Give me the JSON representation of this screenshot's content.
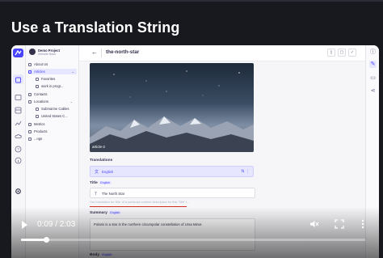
{
  "headline": "Use a Translation String",
  "rail": {
    "tooltip": "Settings"
  },
  "nav": {
    "project_name": "Demo Project",
    "project_sub": "Website Base",
    "items": [
      {
        "label": "About Us"
      },
      {
        "label": "Articles"
      },
      {
        "label": "Favorites"
      },
      {
        "label": "work in progr..."
      },
      {
        "label": "Contacts"
      },
      {
        "label": "Locations"
      },
      {
        "label": "Submarine Cables"
      },
      {
        "label": "United States C..."
      },
      {
        "label": "Metrics"
      },
      {
        "label": "Products"
      },
      {
        "label": "...ngs"
      }
    ]
  },
  "main": {
    "doc_title": "the-north-star",
    "image_caption": "article-2",
    "translations_label": "Translations",
    "translations_value": "English",
    "title_label": "Title",
    "title_badge": "English",
    "title_value": "The North Star",
    "title_hint": "Our translation for 'title' of a particular content description for this 'Title' t...",
    "summary_label": "Summary",
    "summary_badge": "English",
    "summary_value": "Polaris is a star in the northern circumpolar constellation of Ursa Minor.",
    "body_label": "Body",
    "body_badge": "English"
  },
  "video": {
    "current_time": "0:09",
    "duration": "2:03",
    "time_display": "0:09 / 2:03",
    "progress_fraction": 0.073
  },
  "colors": {
    "accent": "#4945ff",
    "error_underline": "#d02b20",
    "background": "#17191f"
  }
}
